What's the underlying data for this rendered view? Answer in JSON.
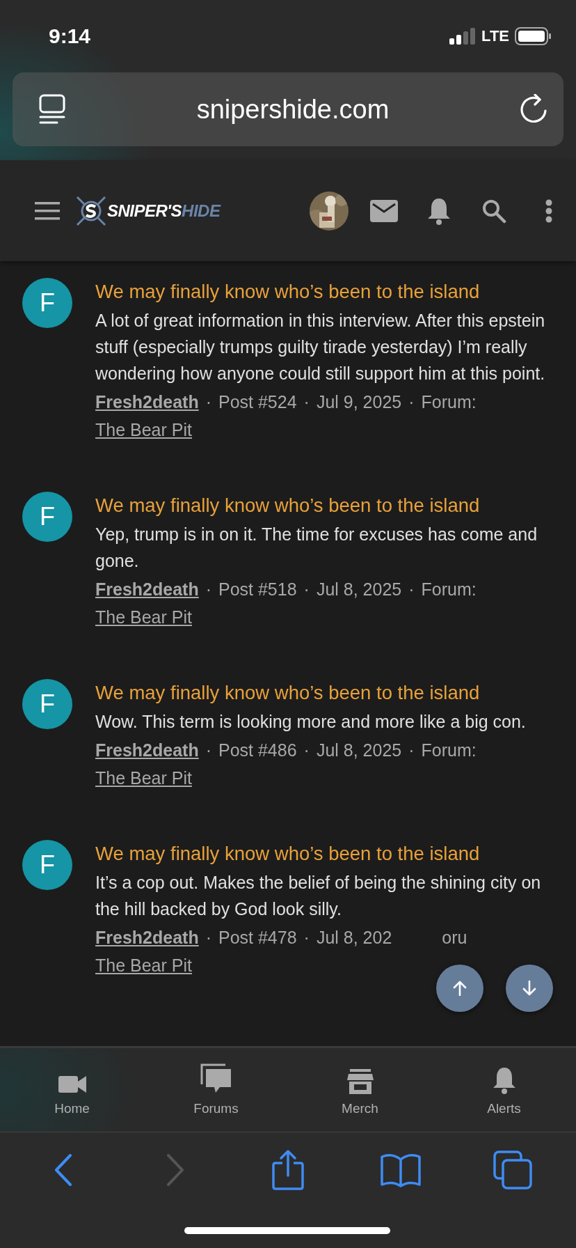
{
  "status_bar": {
    "time": "9:14",
    "network": "LTE"
  },
  "address_bar": {
    "url": "snipershide.com"
  },
  "site_header": {
    "logo": {
      "primary": "SNIPER'S",
      "secondary": "HIDE"
    }
  },
  "posts": [
    {
      "avatar_letter": "F",
      "title": "We may finally know who’s been to the island",
      "body": "A lot of great information in this interview. After this epstein stuff (especially trumps guilty tirade yesterday) I’m really wondering how anyone could still support him at this point.",
      "meta": [
        {
          "kind": "author",
          "text": "Fresh2death"
        },
        {
          "kind": "separator",
          "text": "·"
        },
        {
          "kind": "plain",
          "text": "Post #524"
        },
        {
          "kind": "separator",
          "text": "·"
        },
        {
          "kind": "plain",
          "text": "Jul 9, 2025"
        },
        {
          "kind": "separator",
          "text": "·"
        },
        {
          "kind": "plain",
          "text": "Forum:"
        },
        {
          "kind": "forum",
          "text": "The Bear Pit"
        }
      ]
    },
    {
      "avatar_letter": "F",
      "title": "We may finally know who’s been to the island",
      "body": "Yep, trump is in on it. The time for excuses has come and gone.",
      "meta": [
        {
          "kind": "author",
          "text": "Fresh2death"
        },
        {
          "kind": "separator",
          "text": "·"
        },
        {
          "kind": "plain",
          "text": "Post #518"
        },
        {
          "kind": "separator",
          "text": "·"
        },
        {
          "kind": "plain",
          "text": "Jul 8, 2025"
        },
        {
          "kind": "separator",
          "text": "·"
        },
        {
          "kind": "plain",
          "text": "Forum:"
        },
        {
          "kind": "forum",
          "text": "The Bear Pit"
        }
      ]
    },
    {
      "avatar_letter": "F",
      "title": "We may finally know who’s been to the island",
      "body": "Wow. This term is looking more and more like a big con.",
      "meta": [
        {
          "kind": "author",
          "text": "Fresh2death"
        },
        {
          "kind": "separator",
          "text": "·"
        },
        {
          "kind": "plain",
          "text": "Post #486"
        },
        {
          "kind": "separator",
          "text": "·"
        },
        {
          "kind": "plain",
          "text": "Jul 8, 2025"
        },
        {
          "kind": "separator",
          "text": "·"
        },
        {
          "kind": "plain",
          "text": "Forum:"
        },
        {
          "kind": "forum",
          "text": "The Bear Pit"
        }
      ]
    },
    {
      "avatar_letter": "F",
      "title": "We may finally know who’s been to the island",
      "body": "It’s a cop out. Makes the belief of being the shining city on the hill backed by God look silly.",
      "meta": [
        {
          "kind": "author",
          "text": "Fresh2death"
        },
        {
          "kind": "separator",
          "text": "·"
        },
        {
          "kind": "plain",
          "text": "Post #478"
        },
        {
          "kind": "separator",
          "text": "·"
        },
        {
          "kind": "plain",
          "text": "Jul 8, 202"
        },
        {
          "kind": "fragment",
          "text": "oru"
        },
        {
          "kind": "forum",
          "text": "The Bear Pit"
        }
      ]
    }
  ],
  "bottom_nav": [
    {
      "kind": "video",
      "label": "Home"
    },
    {
      "kind": "chat",
      "label": "Forums"
    },
    {
      "kind": "store",
      "label": "Merch"
    },
    {
      "kind": "bell",
      "label": "Alerts"
    }
  ],
  "browser_toolbar": [
    {
      "kind": "back",
      "disabled": false
    },
    {
      "kind": "forward",
      "disabled": true
    },
    {
      "kind": "share",
      "disabled": false
    },
    {
      "kind": "bookmarks",
      "disabled": false
    },
    {
      "kind": "tabs",
      "disabled": false
    }
  ]
}
